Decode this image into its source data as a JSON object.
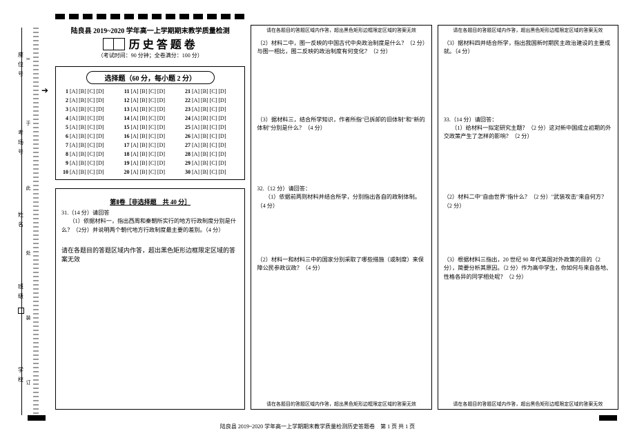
{
  "stub": {
    "labels": [
      "座位号",
      "考场号",
      "姓名",
      "班级",
      "学校"
    ],
    "cut_chars": [
      "✂",
      "于",
      "此",
      "处",
      "装",
      "订"
    ]
  },
  "header": {
    "school_line": "陆良县 2019~2020 学年高一上学期期末教学质量检测",
    "big_title": "历史答题卷",
    "time_line": "（考试时间：90 分钟；全卷满分：100 分）"
  },
  "choice": {
    "title": "选择题（60 分，每小题 2 分）",
    "opt": "[A] [B] [C] [D]",
    "cols": 3,
    "rows": 10
  },
  "partII": {
    "title_line": "第Ⅱ卷［非选择题　共 40 分］",
    "q31_head": "31.（14 分）请回答",
    "q31_1": "（1）依据材料一，指出西周和秦朝所实行的地方行政制度分别是什么？（2分）并说明两个朝代地方行政制度最主要的差别。（4 分）"
  },
  "col2": {
    "q31_2": "（2）材料二中，图一反映的中国古代中央政治制度是什么？（2 分）与图一相比，图二反映的政治制度有何变化？（2 分）",
    "q31_3": "（3）据材料三，结合所学知识，作者所指\"已拆卸的旧体制\"和\"新的体制\"分别是什么？（4 分）",
    "q32_head": "32.（12 分）请回答：",
    "q32_1": "（1）依据前两则材料并结合所学，分别指出各自的政制体制。（4 分）",
    "q32_2": "（2）材料一和材料三中的国家分别采取了哪些措施（或制度）来保障公民参政议政？（4 分）"
  },
  "col3": {
    "q31_4": "（3）据材料四并结合所学，指出我国新时期民主政治建设的主要成就。（4 分）",
    "q33_head": "33.（14 分）请回答：",
    "q33_1": "（1）给材料一拟定研究主题？（2 分）这对新中国成立初期的外交政策产生了怎样的影响？（2 分）",
    "q33_2": "（2）材料二中\"自由世界\"指什么？（2 分）\"武装攻击\"来自何方？（2 分）",
    "q33_3": "（3）根据材料三指出，20 世纪 90 年代美国对外政策的目的（2 分），简要分析其原因。（2 分）作为高中学生，你如何与来自各地、性格各异的同学相处呢？（2 分）"
  },
  "hints": {
    "bottom": "请在各题目的答题区域内作答，超出黑色矩形边框限定区域的答案无效",
    "top": "请在各题目的答题区域内作答，超出黑色矩形边框限定区域的答案无效"
  },
  "footer": "陆良县 2019~2020 学年高一上学期期末教学质量检测历史答题卷　第 1 页 共 1 页"
}
